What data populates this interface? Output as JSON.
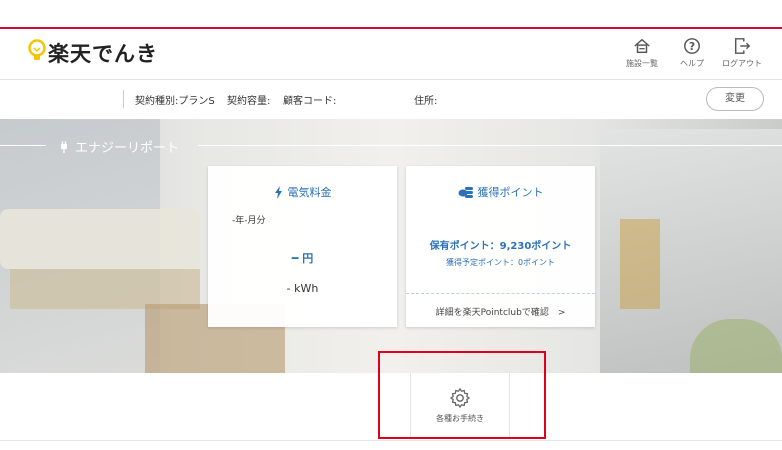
{
  "header": {
    "logo_text": "楽天でんき",
    "nav": [
      {
        "label": "施設一覧",
        "icon": "home-icon"
      },
      {
        "label": "ヘルプ",
        "icon": "help-icon"
      },
      {
        "label": "ログアウト",
        "icon": "logout-icon"
      }
    ]
  },
  "info_bar": {
    "contract_type": "契約種別:プランS",
    "contract_capacity": "契約容量:",
    "customer_code": "顧客コード:",
    "address": "住所:",
    "change_button": "変更"
  },
  "section": {
    "title": "エナジーリポート",
    "icon": "plug-icon"
  },
  "cards": {
    "electricity": {
      "title": "電気料金",
      "icon": "lightning-icon",
      "period": "-年-月分",
      "yen": "━ 円",
      "kwh": "- kWh"
    },
    "points": {
      "title": "獲得ポイント",
      "icon": "coins-icon",
      "held": "保有ポイント：9,230ポイント",
      "planned": "獲得予定ポイント：0ポイント",
      "link": "詳細を楽天Pointclubで確認　>"
    }
  },
  "procedures_tile": {
    "label": "各種お手続き",
    "icon": "gear-icon"
  },
  "colors": {
    "brand_red": "#c8102e",
    "accent_blue": "#2b71b8",
    "highlight_red": "#e0001b",
    "logo_yellow": "#f5c400"
  }
}
